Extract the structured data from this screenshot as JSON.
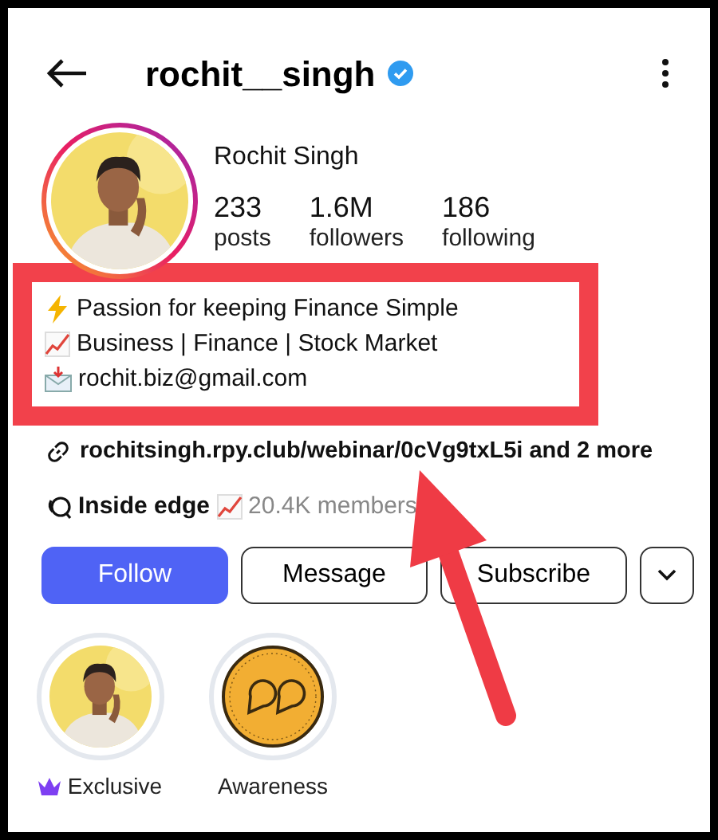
{
  "header": {
    "username": "rochit__singh",
    "verified": true
  },
  "profile": {
    "name": "Rochit Singh",
    "stats": [
      {
        "value": "233",
        "label": "posts"
      },
      {
        "value": "1.6M",
        "label": "followers"
      },
      {
        "value": "186",
        "label": "following"
      }
    ]
  },
  "bio": {
    "lines": [
      {
        "kind": "bolt",
        "text": "Passion for keeping Finance Simple"
      },
      {
        "kind": "chart",
        "text": "Business | Finance | Stock Market"
      },
      {
        "kind": "envelope",
        "text": "rochit.biz@gmail.com"
      }
    ]
  },
  "link": {
    "text": "rochitsingh.rpy.club/webinar/0cVg9txL5i and 2 more"
  },
  "channel": {
    "name": "Inside edge",
    "members": "20.4K members"
  },
  "buttons": [
    {
      "label": "Follow",
      "kind": "primary"
    },
    {
      "label": "Message",
      "kind": "outline"
    },
    {
      "label": "Subscribe",
      "kind": "outline"
    }
  ],
  "highlights": [
    {
      "label": "Exclusive",
      "exclusive": true
    },
    {
      "label": "Awareness",
      "kind": "quote",
      "exclusive": false
    }
  ]
}
